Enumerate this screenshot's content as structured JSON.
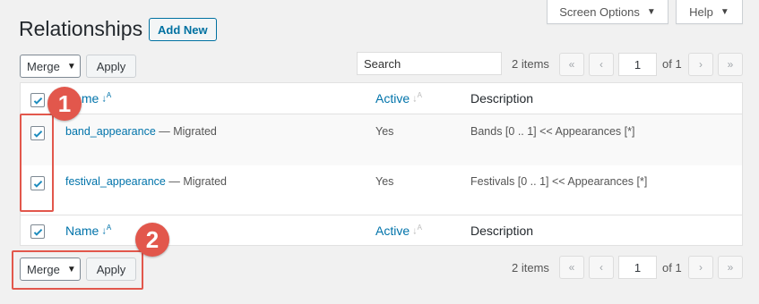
{
  "screen_meta": {
    "screen_options_label": "Screen Options",
    "help_label": "Help"
  },
  "header": {
    "title": "Relationships",
    "add_new_label": "Add New"
  },
  "top_nav": {
    "bulk_action": "Merge",
    "apply_label": "Apply",
    "search_value": "Search",
    "items_count": "2 items",
    "page_input": "1",
    "of_pages": "of 1",
    "first": "«",
    "prev": "‹",
    "next": "›",
    "last": "»"
  },
  "table": {
    "columns": {
      "name": "Name",
      "active": "Active",
      "description": "Description"
    },
    "rows": [
      {
        "name": "band_appearance",
        "suffix": " — Migrated",
        "active": "Yes",
        "description": "Bands [0 .. 1] << Appearances [*]",
        "checked": true
      },
      {
        "name": "festival_appearance",
        "suffix": " — Migrated",
        "active": "Yes",
        "description": "Festivals [0 .. 1] << Appearances [*]",
        "checked": true
      }
    ],
    "footer_columns": {
      "name": "Name",
      "active": "Active",
      "description": "Description"
    }
  },
  "bottom_nav": {
    "bulk_action": "Merge",
    "apply_label": "Apply",
    "items_count": "2 items",
    "page_input": "1",
    "of_pages": "of 1",
    "first": "«",
    "prev": "‹",
    "next": "›",
    "last": "»"
  },
  "annotations": {
    "badge_1": "1",
    "badge_2": "2"
  },
  "colors": {
    "accent": "#0073aa",
    "highlight": "#e2574c"
  }
}
